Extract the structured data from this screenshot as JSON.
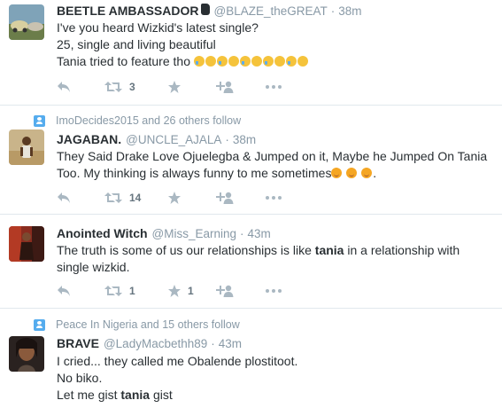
{
  "tweets": [
    {
      "social": "",
      "fullname": "BEETLE AMBASSADOR",
      "username": "@BLAZE_theGREAT",
      "dot": "·",
      "time": "38m",
      "lines": [
        "I've you heard Wizkid's latest single?",
        "25, single and living beautiful",
        "Tania tried to feature tho"
      ],
      "retweets": "3",
      "likes": ""
    },
    {
      "social": "ImoDecides2015 and 26 others follow",
      "fullname": "JAGABAN.",
      "username": "@UNCLE_AJALA",
      "dot": "·",
      "time": "38m",
      "lines": [
        "They Said Drake Love Ojuelegba & Jumped on it, Maybe he Jumped On Tania",
        "Too. My thinking is always funny to me sometimes",
        "."
      ],
      "retweets": "14",
      "likes": ""
    },
    {
      "social": "",
      "fullname": "Anointed Witch",
      "username": "@Miss_Earning",
      "dot": "·",
      "time": "43m",
      "lines": [
        "The truth is some of us our relationships is like ",
        "tania",
        " in a relationship with",
        "single wizkid."
      ],
      "retweets": "1",
      "likes": "1"
    },
    {
      "social": "Peace In Nigeria and 15 others follow",
      "fullname": "BRAVE",
      "username": "@LadyMacbethh89",
      "dot": "·",
      "time": "43m",
      "lines": [
        "I cried... they called me Obalende plostitoot.",
        "No biko.",
        "Let me gist ",
        "tania",
        " gist"
      ],
      "retweets": "",
      "likes": ""
    }
  ],
  "colors": {
    "accent": "#55acee",
    "muted": "#8899a6",
    "action": "#aab8c2",
    "text": "#292f33"
  },
  "icons": [
    "reply-icon",
    "retweet-icon",
    "like-icon",
    "follow-icon",
    "more-icon",
    "cry-emoji",
    "smile-emoji",
    "hand-icon"
  ]
}
